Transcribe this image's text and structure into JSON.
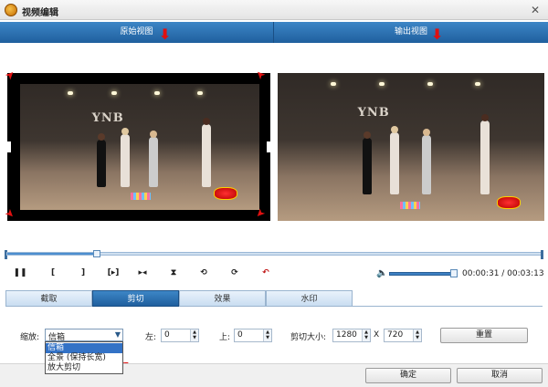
{
  "window": {
    "title": "视频编辑",
    "close_glyph": "✕"
  },
  "views": {
    "original_label": "原始视图",
    "output_label": "输出视图"
  },
  "video": {
    "wall_text": "YNB"
  },
  "annotations": {
    "arrow_down_glyph": "⬇",
    "check_glyph": "✔"
  },
  "playback": {
    "progress": 0.168,
    "volume": 0.95,
    "time_display": "00:00:31 / 00:03:13",
    "buttons": [
      {
        "name": "pause-button",
        "glyph": "❚❚"
      },
      {
        "name": "mark-in-button",
        "glyph": "["
      },
      {
        "name": "mark-out-button",
        "glyph": "]"
      },
      {
        "name": "play-selection-button",
        "glyph": "[▸]"
      },
      {
        "name": "next-frame-button",
        "glyph": "▸◂"
      },
      {
        "name": "trim-button",
        "glyph": "⧗"
      },
      {
        "name": "rotate-left-button",
        "glyph": "⟲"
      },
      {
        "name": "rotate-right-button",
        "glyph": "⟳"
      },
      {
        "name": "undo-button",
        "glyph": "↶"
      }
    ]
  },
  "tabs": [
    {
      "label": "截取",
      "active": false
    },
    {
      "label": "剪切",
      "active": true
    },
    {
      "label": "效果",
      "active": false
    },
    {
      "label": "水印",
      "active": false
    }
  ],
  "crop": {
    "zoom_label": "缩放:",
    "zoom_value": "信箱",
    "zoom_options": [
      "信箱",
      "全景 (保持长宽)",
      "放大剪切"
    ],
    "left_label": "左:",
    "left_value": "0",
    "top_label": "上:",
    "top_value": "0",
    "size_label": "剪切大小:",
    "width_value": "1280",
    "times": "X",
    "height_value": "720",
    "reset_label": "重置"
  },
  "footer": {
    "ok_label": "确定",
    "cancel_label": "取消"
  },
  "colors": {
    "header_blue": "#2a6fb0",
    "annotation_red": "#e01010",
    "selected_item": "#3372c6"
  }
}
